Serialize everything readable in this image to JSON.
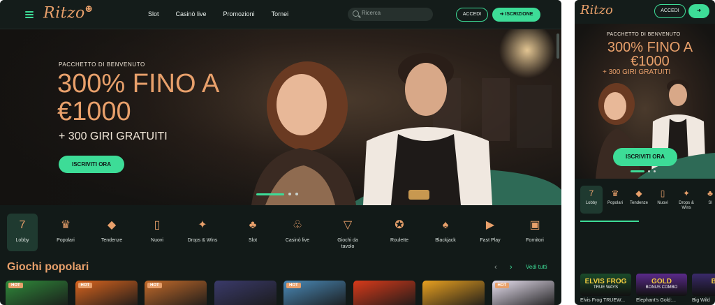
{
  "header": {
    "logo": "Ritzo",
    "nav": [
      "Slot",
      "Casinò live",
      "Promozioni",
      "Tornei"
    ],
    "search_placeholder": "Ricerca",
    "login_label": "ACCEDI",
    "signup_label": "ISCRIZIONE"
  },
  "hero": {
    "kicker": "PACCHETTO DI BENVENUTO",
    "headline": "300% FINO A €1000",
    "subline": "+ 300 GIRI GRATUITI",
    "cta_label": "ISCRIVITI ORA"
  },
  "categories": [
    {
      "label": "Lobby",
      "icon": "seven-icon",
      "glyph": "7"
    },
    {
      "label": "Popolari",
      "icon": "laurel-icon",
      "glyph": "♛"
    },
    {
      "label": "Tendenze",
      "icon": "diamond-icon",
      "glyph": "◆"
    },
    {
      "label": "Nuovi",
      "icon": "door-tag-icon",
      "glyph": "▯"
    },
    {
      "label": "Drops & Wins",
      "icon": "drops-wins-icon",
      "glyph": "✦"
    },
    {
      "label": "Slot",
      "icon": "cherry-icon",
      "glyph": "♣"
    },
    {
      "label": "Casinò live",
      "icon": "chips-icon",
      "glyph": "♧"
    },
    {
      "label": "Giochi da tavolo",
      "icon": "cocktail-icon",
      "glyph": "▽"
    },
    {
      "label": "Roulette",
      "icon": "roulette-icon",
      "glyph": "✪"
    },
    {
      "label": "Blackjack",
      "icon": "cards-icon",
      "glyph": "♠"
    },
    {
      "label": "Fast Play",
      "icon": "play-icon",
      "glyph": "▶"
    },
    {
      "label": "Fornitori",
      "icon": "provider-icon",
      "glyph": "▣"
    }
  ],
  "popular": {
    "title": "Giochi popolari",
    "see_all": "Vedi tutti",
    "hot_badge": "HOT",
    "tile_colors": [
      "#2f8a3a",
      "#d8641e",
      "#c26a2a",
      "#3a3a6a",
      "#4a8ab8",
      "#d83a1a",
      "#e8a020",
      "#e8e0f0"
    ]
  },
  "mobile": {
    "logo": "Ritzo",
    "login_label": "ACCEDI",
    "hero_kicker": "PACCHETTO DI BENVENUTO",
    "hero_headline": "300% FINO A €1000",
    "hero_subline": "+ 300 GIRI GRATUITI",
    "cta_label": "ISCRIVITI ORA",
    "categories": [
      "Lobby",
      "Popolari",
      "Tendenze",
      "Nuovi",
      "Drops & Wins",
      "Sl"
    ],
    "games": [
      {
        "title": "Elvis Frog TRUEW...",
        "art": "ELVIS FROG",
        "art2": "TRUE WAYS",
        "color": "#1a4a2a"
      },
      {
        "title": "Elephant's Gold:...",
        "art": "GOLD",
        "art2": "BONUS COMBO",
        "color": "#5a2a8a"
      },
      {
        "title": "Big Wild",
        "art": "BIG",
        "art2": "",
        "color": "#3a2a6a"
      }
    ]
  }
}
